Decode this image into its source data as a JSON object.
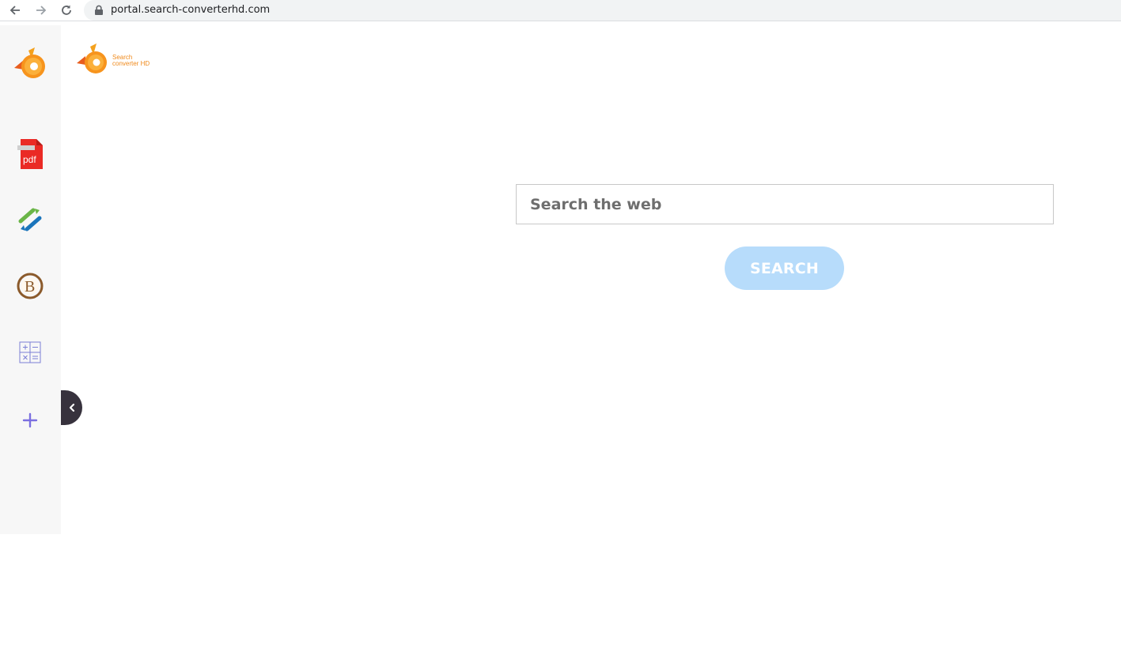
{
  "browser": {
    "url": "portal.search-converterhd.com"
  },
  "header": {
    "logo_line1": "Search",
    "logo_line2": "converter HD"
  },
  "sidebar": {
    "items": [
      {
        "icon": "logo-icon"
      },
      {
        "icon": "pdf-icon",
        "label": "pdf"
      },
      {
        "icon": "converter-arrows-icon"
      },
      {
        "icon": "bitcoin-icon",
        "label": "B"
      },
      {
        "icon": "calculator-icon"
      },
      {
        "icon": "plus-icon"
      }
    ]
  },
  "search": {
    "placeholder": "Search the web",
    "button_label": "SEARCH"
  },
  "colors": {
    "brand_orange": "#f7941d",
    "sidebar_bg": "#f7f7f7",
    "button_bg": "#b7dcfb",
    "collapse_tab": "#37323d"
  }
}
